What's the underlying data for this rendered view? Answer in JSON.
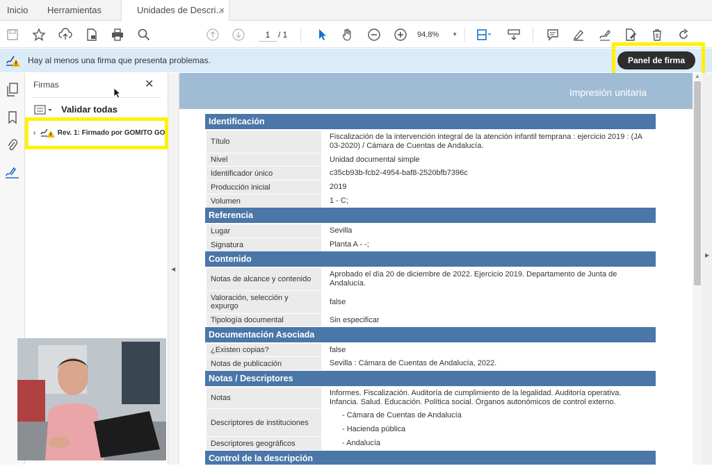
{
  "tabs": [
    "Inicio",
    "Herramientas",
    "Unidades de Descri..."
  ],
  "tab_close": "×",
  "toolbar": {
    "page_current": "1",
    "page_total": "/ 1",
    "zoom": "94,8%"
  },
  "banner": {
    "message": "Hay al menos una firma que presenta problemas.",
    "panel_button": "Panel de firma"
  },
  "signatures": {
    "title": "Firmas",
    "close": "✕",
    "validate_all": "Validar todas",
    "revision": "Rev. 1: Firmado por GOMITO GO"
  },
  "document": {
    "header": "Impresión unitaria",
    "sections": [
      {
        "title": "Identificación",
        "rows": [
          {
            "label": "Título",
            "value": "Fiscalización de la intervención integral de la atención infantil temprana : ejercicio 2019 : (JA 03-2020) / Cámara de Cuentas de Andalucía."
          },
          {
            "label": "Nivel",
            "value": "Unidad documental simple"
          },
          {
            "label": "Identificador único",
            "value": "c35cb93b-fcb2-4954-baf8-2520bfb7396c"
          },
          {
            "label": "Producción inicial",
            "value": "2019"
          },
          {
            "label": "Volumen",
            "value": "1 - C;"
          }
        ]
      },
      {
        "title": "Referencia",
        "rows": [
          {
            "label": "Lugar",
            "value": "Sevilla"
          },
          {
            "label": "Signatura",
            "value": "Planta A - -;"
          }
        ]
      },
      {
        "title": "Contenido",
        "rows": [
          {
            "label": "Notas de alcance y contenido",
            "value": "Aprobado el día 20 de diciembre de 2022. Ejercicio 2019. Departamento de Junta de Andalucía."
          },
          {
            "label": "Valoración, selección y expurgo",
            "value": "false"
          },
          {
            "label": "Tipología documental",
            "value": "Sin especificar"
          }
        ]
      },
      {
        "title": "Documentación Asociada",
        "rows": [
          {
            "label": "¿Existen copias?",
            "value": "false"
          },
          {
            "label": "Notas de publicación",
            "value": "Sevilla : Cámara de Cuentas de Andalucía, 2022."
          }
        ]
      },
      {
        "title": "Notas / Descriptores",
        "rows": [
          {
            "label": "Notas",
            "value": "Informes. Fiscalización. Auditoría de cumplimiento de la legalidad. Auditoría operativa. Infancia. Salud. Educación. Política social. Órganos autonómicos de control externo."
          },
          {
            "label": "Descriptores de instituciones",
            "value": "",
            "list": [
              "- Cámara de Cuentas de Andalucía",
              "- Hacienda pública"
            ]
          },
          {
            "label": "Descriptores geográficos",
            "value": "- Andalucía"
          }
        ]
      },
      {
        "title": "Control de la descripción",
        "rows": []
      }
    ]
  }
}
